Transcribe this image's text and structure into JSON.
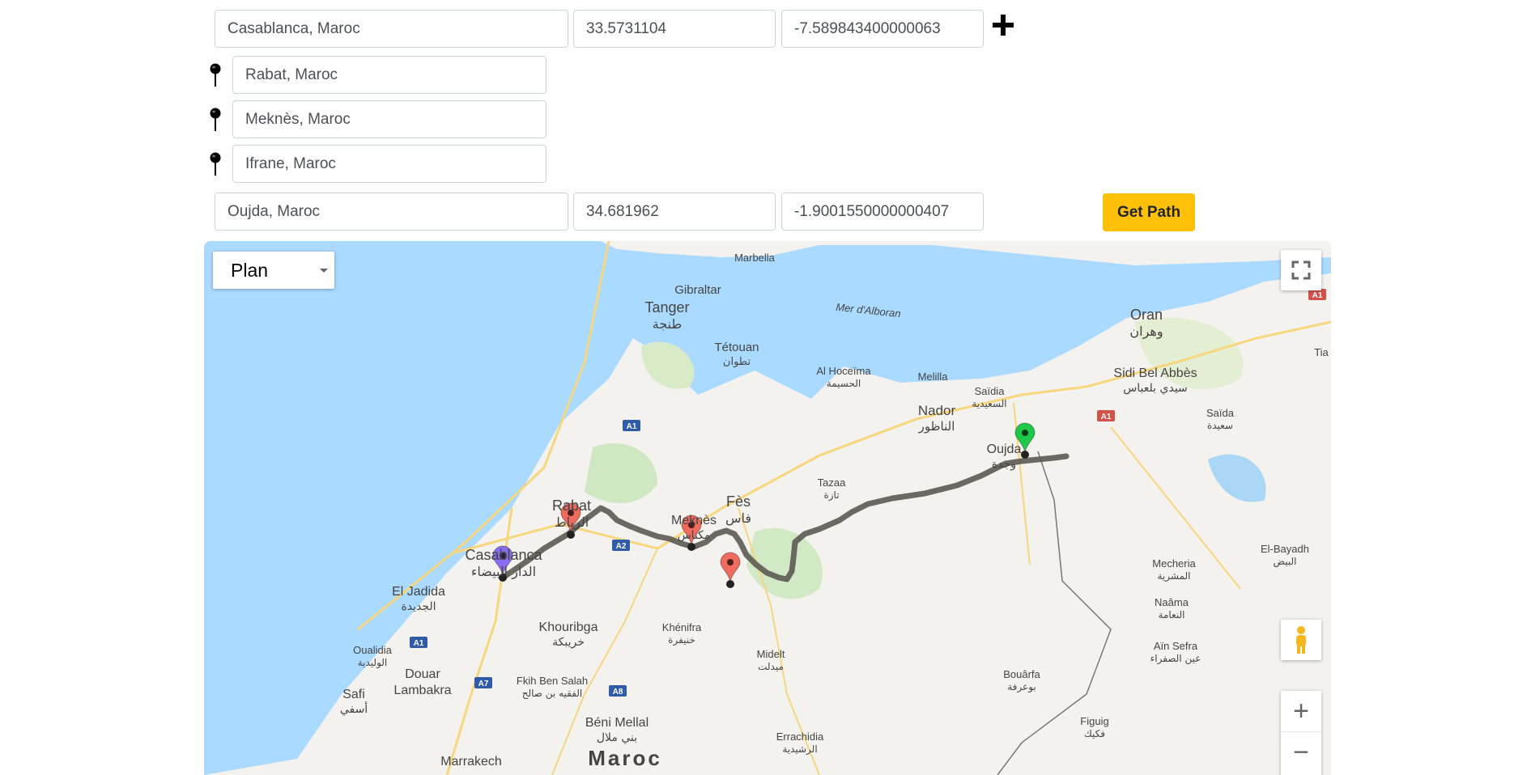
{
  "waypoints": {
    "origin": {
      "place": "Casablanca, Maroc",
      "lat": "33.5731104",
      "lng": "-7.589843400000063"
    },
    "stops": [
      "Rabat, Maroc",
      "Meknès, Maroc",
      "Ifrane, Maroc"
    ],
    "destination": {
      "place": "Oujda, Maroc",
      "lat": "34.681962",
      "lng": "-1.9001550000000407"
    }
  },
  "actions": {
    "add_icon": "plus-icon",
    "get_path_label": "Get Path"
  },
  "map": {
    "map_type": {
      "selected": "Plan"
    },
    "sea_label": "Mer d'Alboran",
    "cities": [
      {
        "name": "Marbella"
      },
      {
        "name": "Gibraltar"
      },
      {
        "name": "Tanger",
        "ar": "طنجة"
      },
      {
        "name": "Tétouan",
        "ar": "تطوان"
      },
      {
        "name": "Al Hoceïma",
        "ar": "الحسيمة"
      },
      {
        "name": "Melilla"
      },
      {
        "name": "Nador",
        "ar": "الناظور"
      },
      {
        "name": "Saïdia",
        "ar": "السعيدية"
      },
      {
        "name": "Oran",
        "ar": "وهران"
      },
      {
        "name": "Sidi Bel Abbès",
        "ar": "سيدي بلعباس"
      },
      {
        "name": "Saïda",
        "ar": "سعيدة"
      },
      {
        "name": "Tia"
      },
      {
        "name": "Oujda",
        "ar": "وجدة"
      },
      {
        "name": "Tazaa",
        "ar": "تازة"
      },
      {
        "name": "Fès",
        "ar": "فاس"
      },
      {
        "name": "Meknès",
        "ar": "مكناس"
      },
      {
        "name": "Rabat",
        "ar": "الرباط"
      },
      {
        "name": "Casablanca",
        "ar": "الدار البيضاء"
      },
      {
        "name": "El Jadida",
        "ar": "الجديدة"
      },
      {
        "name": "Khouribga",
        "ar": "خريبكة"
      },
      {
        "name": "Khénifra",
        "ar": "خنيفرة"
      },
      {
        "name": "Midelt",
        "ar": "ميدلت"
      },
      {
        "name": "Mecheria",
        "ar": "المشرية"
      },
      {
        "name": "El-Bayadh",
        "ar": "البيض"
      },
      {
        "name": "Naâma",
        "ar": "النعامة"
      },
      {
        "name": "Aïn Sefra",
        "ar": "عين الصفراء"
      },
      {
        "name": "Bouârfa",
        "ar": "بوعرفة"
      },
      {
        "name": "Figuig",
        "ar": "فكيك"
      },
      {
        "name": "Errachidia",
        "ar": "الرشيدية"
      },
      {
        "name": "Oualidia",
        "ar": "الوليدية"
      },
      {
        "name": "Safi",
        "ar": "أسفي"
      },
      {
        "name": "Douar Lambakra"
      },
      {
        "name": "Fkih Ben Salah",
        "ar": "الفقيه بن صالح"
      },
      {
        "name": "Béni Mellal",
        "ar": "بني ملال"
      },
      {
        "name": "Marrakech"
      },
      {
        "name": "Maroc"
      }
    ],
    "road_shields": [
      "A1",
      "A1",
      "A2",
      "A1",
      "A7",
      "A8",
      "A1"
    ],
    "colors": {
      "water": "#aadaff",
      "land": "#f4f2ee",
      "route": "#5c5a52",
      "marker_origin": "#8a6cf0",
      "marker_stop": "#ee6b5e",
      "marker_destination": "#1ec94a",
      "accent": "#ffc107"
    },
    "controls": {
      "fullscreen_icon": "fullscreen-icon",
      "pegman_icon": "pegman-icon",
      "zoom_in": "+",
      "zoom_out": "−"
    }
  }
}
